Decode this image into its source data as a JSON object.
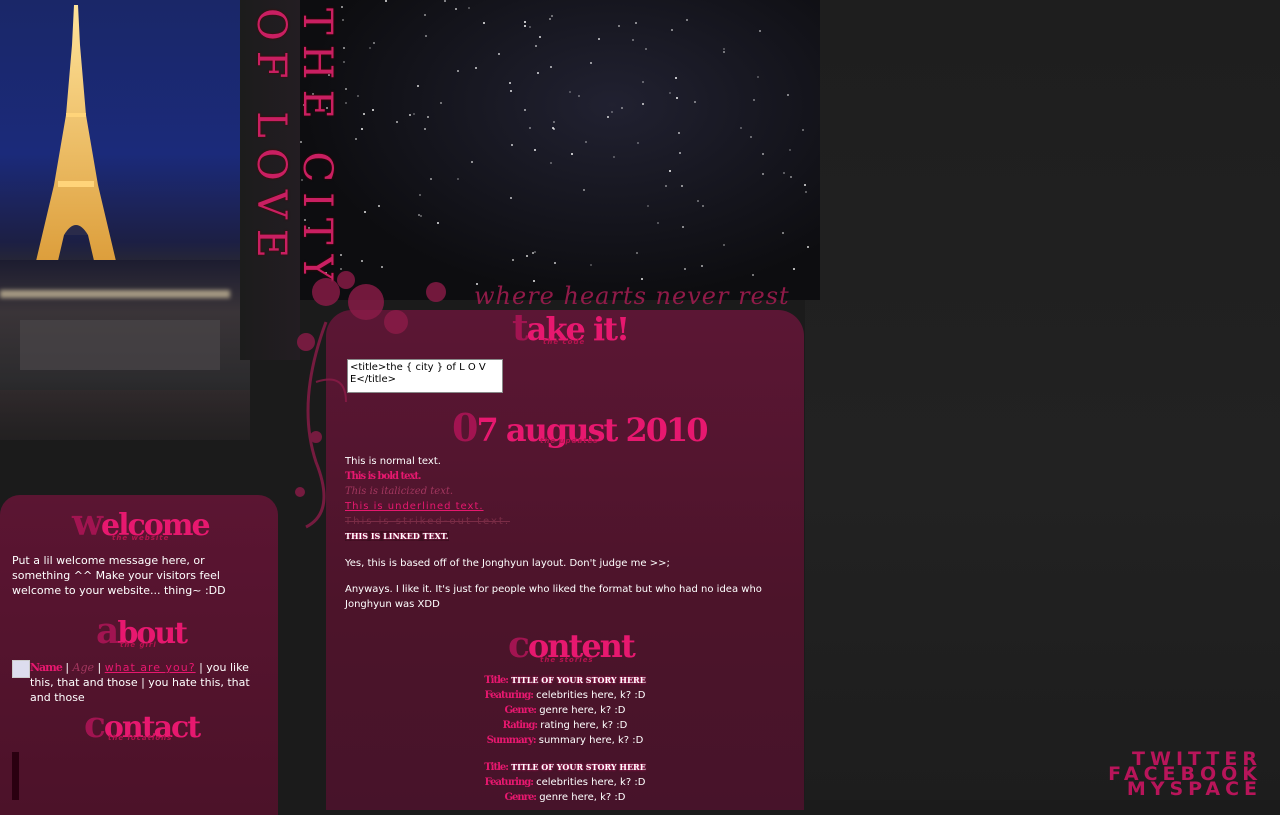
{
  "header": {
    "vertical_title": "THE CITY OF LOVE",
    "tagline": "where hearts never rest"
  },
  "sidebar": {
    "welcome": {
      "first": "w",
      "rest": "elcome",
      "sub": "the website",
      "text": "Put a lil welcome message here, or something ^^ Make your visitors feel welcome to your website... thing~ :DD"
    },
    "about": {
      "first": "a",
      "rest": "bout",
      "sub": "the girl",
      "name_label": "Name",
      "sep1": " | ",
      "age_label": "Age",
      "sep2": " | ",
      "what_link": "what are you?",
      "text": " | you like this, that and those | you hate this, that and those"
    },
    "contact": {
      "first": "c",
      "rest": "ontact",
      "sub": "the locations",
      "links": [
        "TWITTER",
        "FACEBOOK",
        "MYSPACE"
      ]
    }
  },
  "main": {
    "take": {
      "first": "t",
      "rest": "ake it!",
      "sub": "the code",
      "code_value": "<title>the { city } of L O V E</title>"
    },
    "date": {
      "first": "0",
      "rest": "7 august 2010",
      "sub": "the updates"
    },
    "formats": {
      "normal": "This is normal text.",
      "bold": "This is bold text.",
      "italic": "This is italicized text.",
      "underline": "This is underlined text.",
      "strike": "This is striked-out text.",
      "linked": "THIS IS LINKED TEXT."
    },
    "paragraphs": [
      "Yes, this is based off of the Jonghyun layout. Don't judge me >>;",
      "Anyways. I like it. It's just for people who liked the format but who had no idea who Jonghyun was XDD"
    ],
    "content": {
      "first": "c",
      "rest": "ontent",
      "sub": "the stories"
    },
    "story_fields": {
      "title_label": "Title:",
      "title_value": "TITLE OF YOUR STORY HERE",
      "featuring_label": "Featuring:",
      "featuring_value": "celebrities here, k? :D",
      "genre_label": "Genre:",
      "genre_value": "genre here, k? :D",
      "rating_label": "Rating:",
      "rating_value": "rating here, k? :D",
      "summary_label": "Summary:",
      "summary_value": "summary here, k? :D"
    }
  },
  "colors": {
    "accent": "#e7186f",
    "panel": "#5b1634",
    "background": "#1b1b1b"
  }
}
